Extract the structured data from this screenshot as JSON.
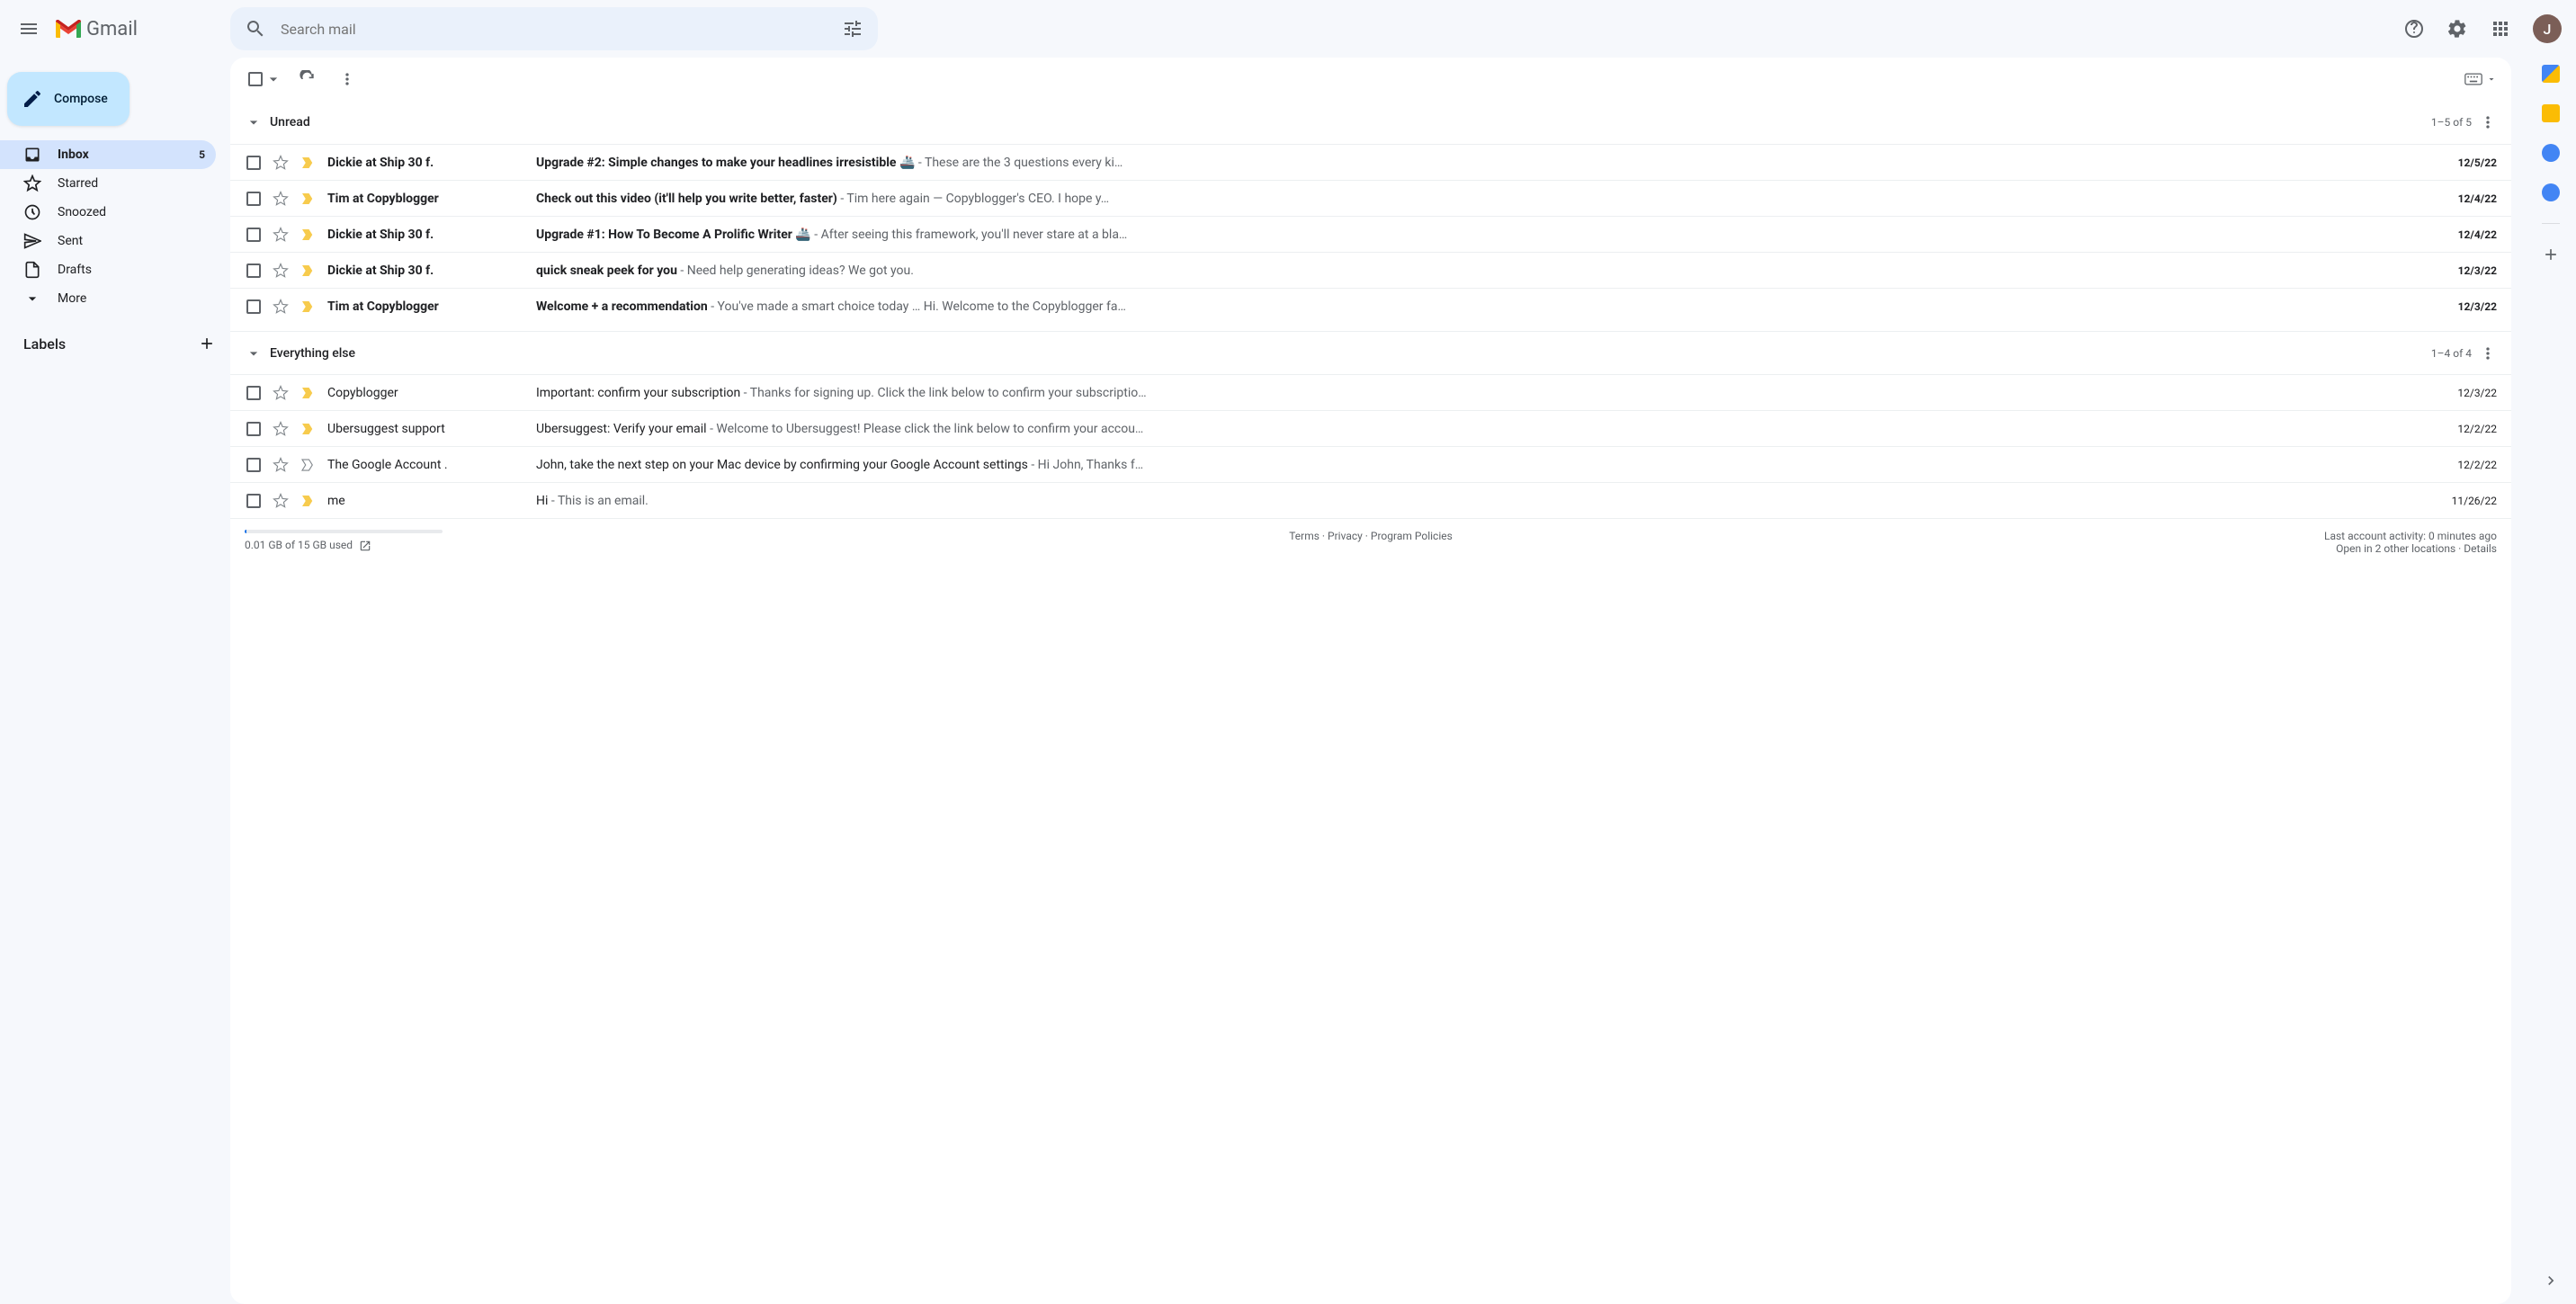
{
  "header": {
    "search_placeholder": "Search mail",
    "avatar_initial": "J"
  },
  "sidebar": {
    "compose_label": "Compose",
    "items": [
      {
        "label": "Inbox",
        "count": "5",
        "active": true
      },
      {
        "label": "Starred"
      },
      {
        "label": "Snoozed"
      },
      {
        "label": "Sent"
      },
      {
        "label": "Drafts"
      },
      {
        "label": "More"
      }
    ],
    "labels_header": "Labels"
  },
  "sections": {
    "unread": {
      "title": "Unread",
      "count": "1–5 of 5",
      "rows": [
        {
          "sender": "Dickie at Ship 30 f.",
          "subject": "Upgrade #2: Simple changes to make your headlines irresistible 🚢",
          "preview": " - These are the 3 questions every ki…",
          "date": "12/5/22",
          "important": true
        },
        {
          "sender": "Tim at Copyblogger",
          "subject": "Check out this video (it'll help you write better, faster)",
          "preview": " - Tim here again — Copyblogger's CEO. I hope y…",
          "date": "12/4/22",
          "important": true
        },
        {
          "sender": "Dickie at Ship 30 f.",
          "subject": "Upgrade #1: How To Become A Prolific Writer 🚢",
          "preview": " - After seeing this framework, you'll never stare at a bla…",
          "date": "12/4/22",
          "important": true
        },
        {
          "sender": "Dickie at Ship 30 f.",
          "subject": "quick sneak peek for you",
          "preview": " - Need help generating ideas? We got you.",
          "date": "12/3/22",
          "important": true
        },
        {
          "sender": "Tim at Copyblogger",
          "subject": "Welcome + a recommendation",
          "preview": " - You've made a smart choice today … Hi. Welcome to the Copyblogger fa…",
          "date": "12/3/22",
          "important": true
        }
      ]
    },
    "else": {
      "title": "Everything else",
      "count": "1–4 of 4",
      "rows": [
        {
          "sender": "Copyblogger",
          "subject": "Important: confirm your subscription",
          "preview": " - Thanks for signing up. Click the link below to confirm your subscriptio…",
          "date": "12/3/22",
          "important": true
        },
        {
          "sender": "Ubersuggest support",
          "subject": "Ubersuggest: Verify your email",
          "preview": " - Welcome to Ubersuggest! Please click the link below to confirm your accou…",
          "date": "12/2/22",
          "important": true
        },
        {
          "sender": "The Google Account .",
          "subject": "John, take the next step on your Mac device by confirming your Google Account settings",
          "preview": " - Hi John, Thanks f…",
          "date": "12/2/22",
          "important": false
        },
        {
          "sender": "me",
          "subject": "Hi",
          "preview": " - This is an email.",
          "date": "11/26/22",
          "important": true
        }
      ]
    }
  },
  "footer": {
    "storage": "0.01 GB of 15 GB used",
    "terms": "Terms",
    "privacy": "Privacy",
    "policies": "Program Policies",
    "activity": "Last account activity: 0 minutes ago",
    "locations": "Open in 2 other locations",
    "details": "Details"
  },
  "logo_text": "Gmail"
}
